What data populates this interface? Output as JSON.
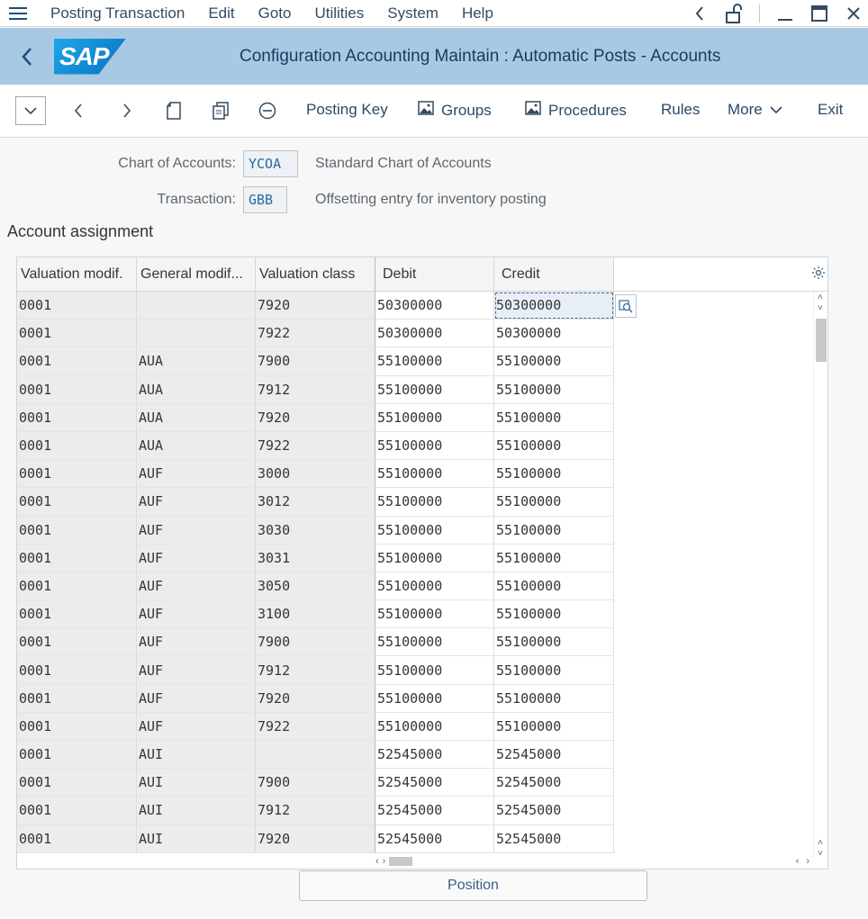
{
  "menu": {
    "items": [
      "Posting Transaction",
      "Edit",
      "Goto",
      "Utilities",
      "System",
      "Help"
    ]
  },
  "title": "Configuration Accounting Maintain : Automatic Posts - Accounts",
  "toolbar": {
    "posting_key": "Posting Key",
    "groups": "Groups",
    "procedures": "Procedures",
    "rules": "Rules",
    "more": "More",
    "exit": "Exit"
  },
  "header": {
    "chart_label": "Chart of Accounts:",
    "chart_value": "YCOA",
    "chart_desc": "Standard Chart of Accounts",
    "transaction_label": "Transaction:",
    "transaction_value": "GBB",
    "transaction_desc": "Offsetting entry for inventory posting"
  },
  "section_title": "Account assignment",
  "table": {
    "columns": [
      "Valuation modif.",
      "General modif...",
      "Valuation class",
      "Debit",
      "Credit"
    ],
    "rows": [
      [
        "0001",
        "",
        "7920",
        "50300000",
        "50300000"
      ],
      [
        "0001",
        "",
        "7922",
        "50300000",
        "50300000"
      ],
      [
        "0001",
        "AUA",
        "7900",
        "55100000",
        "55100000"
      ],
      [
        "0001",
        "AUA",
        "7912",
        "55100000",
        "55100000"
      ],
      [
        "0001",
        "AUA",
        "7920",
        "55100000",
        "55100000"
      ],
      [
        "0001",
        "AUA",
        "7922",
        "55100000",
        "55100000"
      ],
      [
        "0001",
        "AUF",
        "3000",
        "55100000",
        "55100000"
      ],
      [
        "0001",
        "AUF",
        "3012",
        "55100000",
        "55100000"
      ],
      [
        "0001",
        "AUF",
        "3030",
        "55100000",
        "55100000"
      ],
      [
        "0001",
        "AUF",
        "3031",
        "55100000",
        "55100000"
      ],
      [
        "0001",
        "AUF",
        "3050",
        "55100000",
        "55100000"
      ],
      [
        "0001",
        "AUF",
        "3100",
        "55100000",
        "55100000"
      ],
      [
        "0001",
        "AUF",
        "7900",
        "55100000",
        "55100000"
      ],
      [
        "0001",
        "AUF",
        "7912",
        "55100000",
        "55100000"
      ],
      [
        "0001",
        "AUF",
        "7920",
        "55100000",
        "55100000"
      ],
      [
        "0001",
        "AUF",
        "7922",
        "55100000",
        "55100000"
      ],
      [
        "0001",
        "AUI",
        "",
        "52545000",
        "52545000"
      ],
      [
        "0001",
        "AUI",
        "7900",
        "52545000",
        "52545000"
      ],
      [
        "0001",
        "AUI",
        "7912",
        "52545000",
        "52545000"
      ],
      [
        "0001",
        "AUI",
        "7920",
        "52545000",
        "52545000"
      ]
    ]
  },
  "position_button": "Position"
}
